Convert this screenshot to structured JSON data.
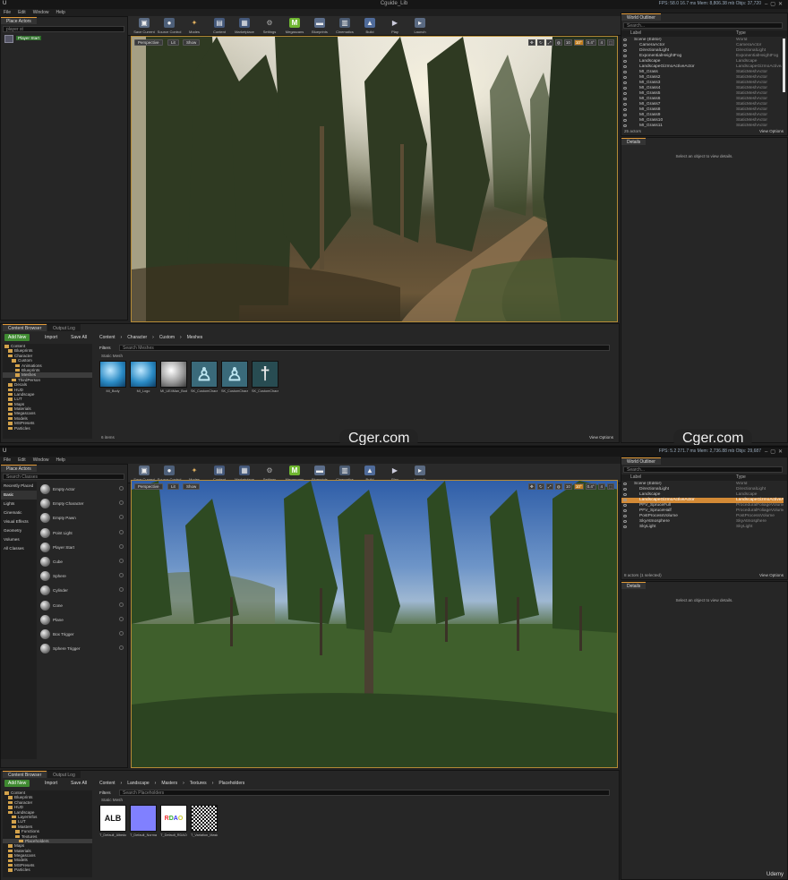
{
  "editor1": {
    "title": "Cguide_Lib",
    "stats": "FPS: 58.0   16.7 ms   Mem: 8,806.38 mb   Objs: 37,720",
    "menu": [
      "File",
      "Edit",
      "Window",
      "Help"
    ],
    "place_actors_tab": "Place Actors",
    "search_text": "player st",
    "place_result": "Player Start",
    "toolbar": [
      "Save Current",
      "Source Control",
      "Modes",
      "Content",
      "Marketplace",
      "Settings",
      "Megascans",
      "Blueprints",
      "Cinematics",
      "Build",
      "Play",
      "Launch"
    ],
    "viewport_buttons": [
      "Perspective",
      "Lit",
      "Show"
    ],
    "viewport_right": [
      "10",
      "10°",
      "0.4°",
      "4",
      "0.02",
      "1.0",
      "Unlit",
      "Editor"
    ],
    "world_outliner_tab": "World Outliner",
    "outliner_search": "Search...",
    "outliner_cols": [
      "Label",
      "Type"
    ],
    "outliner_rows": [
      {
        "label": "Scene (Editor)",
        "type": "World"
      },
      {
        "label": "CameraActor",
        "type": "CameraActor"
      },
      {
        "label": "DirectionalLight",
        "type": "DirectionalLight"
      },
      {
        "label": "ExponentialHeightFog",
        "type": "ExponentialHeightFog"
      },
      {
        "label": "Landscape",
        "type": "Landscape"
      },
      {
        "label": "LandscapeGizmoActiveActor",
        "type": "LandscapeGizmoActiveActor"
      },
      {
        "label": "MI_Grass",
        "type": "StaticMeshActor"
      },
      {
        "label": "MI_Grass2",
        "type": "StaticMeshActor"
      },
      {
        "label": "MI_Grass3",
        "type": "StaticMeshActor"
      },
      {
        "label": "MI_Grass4",
        "type": "StaticMeshActor"
      },
      {
        "label": "MI_Grass5",
        "type": "StaticMeshActor"
      },
      {
        "label": "MI_Grass6",
        "type": "StaticMeshActor"
      },
      {
        "label": "MI_Grass7",
        "type": "StaticMeshActor"
      },
      {
        "label": "MI_Grass8",
        "type": "StaticMeshActor"
      },
      {
        "label": "MI_Grass9",
        "type": "StaticMeshActor"
      },
      {
        "label": "MI_Grass10",
        "type": "StaticMeshActor"
      },
      {
        "label": "MI_Grass11",
        "type": "StaticMeshActor"
      }
    ],
    "outliner_count": "25 actors",
    "view_options": "View Options",
    "details_tab": "Details",
    "details_msg": "Select an object to view details.",
    "content_browser_tab": "Content Browser",
    "output_log_tab": "Output Log",
    "add_new": "Add New",
    "import": "Import",
    "save_all": "Save All",
    "breadcrumb": [
      "Content",
      "Character",
      "Custom",
      "Meshes"
    ],
    "filters": "Filters",
    "search_assets": "Search Meshes",
    "section_label": "Static Mesh",
    "tree": [
      {
        "label": "Content",
        "indent": 0
      },
      {
        "label": "Blueprints",
        "indent": 1
      },
      {
        "label": "Character",
        "indent": 1
      },
      {
        "label": "Custom",
        "indent": 2
      },
      {
        "label": "Animations",
        "indent": 3
      },
      {
        "label": "Blueprints",
        "indent": 3
      },
      {
        "label": "Meshes",
        "indent": 3,
        "sel": true
      },
      {
        "label": "ThirdPerson",
        "indent": 2
      },
      {
        "label": "Decals",
        "indent": 1
      },
      {
        "label": "HUD",
        "indent": 1
      },
      {
        "label": "Landscape",
        "indent": 1
      },
      {
        "label": "LUT",
        "indent": 1
      },
      {
        "label": "Maps",
        "indent": 1
      },
      {
        "label": "Materials",
        "indent": 1
      },
      {
        "label": "Megascans",
        "indent": 1
      },
      {
        "label": "Models",
        "indent": 1
      },
      {
        "label": "MSPresets",
        "indent": 1
      },
      {
        "label": "Particles",
        "indent": 1
      }
    ],
    "assets": [
      {
        "name": "MI_Body",
        "kind": "ball-blue"
      },
      {
        "name": "MI_Logo",
        "kind": "ball-blue"
      },
      {
        "name": "MI_UE4Man_Body",
        "kind": "ball-gray"
      },
      {
        "name": "SK_CustomChara",
        "kind": "figure"
      },
      {
        "name": "SK_CustomChara_PhysicsAsset",
        "kind": "figure"
      },
      {
        "name": "SK_CustomChara_Skeleton",
        "kind": "skeleton"
      }
    ],
    "items_count": "6 items",
    "watermark": "Cger.com"
  },
  "editor2": {
    "stats": "FPS: 5.2   271.7 ms   Mem: 2,736.88 mb   Objs: 29,687",
    "menu": [
      "File",
      "Edit",
      "Window",
      "Help"
    ],
    "place_actors_tab": "Place Actors",
    "search_classes": "Search Classes",
    "categories": [
      "Recently Placed",
      "Basic",
      "Lights",
      "Cinematic",
      "Visual Effects",
      "Geometry",
      "Volumes",
      "All Classes"
    ],
    "active_category": "Basic",
    "actors": [
      "Empty Actor",
      "Empty Character",
      "Empty Pawn",
      "Point Light",
      "Player Start",
      "Cube",
      "Sphere",
      "Cylinder",
      "Cone",
      "Plane",
      "Box Trigger",
      "Sphere Trigger"
    ],
    "toolbar": [
      "Save Current",
      "Source Control",
      "Modes",
      "Content",
      "Marketplace",
      "Settings",
      "Megascans",
      "Blueprints",
      "Cinematics",
      "Build",
      "Play",
      "Launch"
    ],
    "viewport_buttons": [
      "Perspective",
      "Lit",
      "Show"
    ],
    "viewport_right": [
      "10",
      "10°",
      "0.4°",
      "4",
      "0.02",
      "1.0"
    ],
    "world_outliner_tab": "World Outliner",
    "outliner_search": "Search...",
    "outliner_cols": [
      "Label",
      "Type"
    ],
    "outliner_rows": [
      {
        "label": "Scene (Editor)",
        "type": "World"
      },
      {
        "label": "DirectionalLight",
        "type": "DirectionalLight"
      },
      {
        "label": "Landscape",
        "type": "Landscape"
      },
      {
        "label": "LandscapeGizmoActiveActor",
        "type": "LandscapeGizmoActiveActor",
        "sel": true
      },
      {
        "label": "PFV_SpruceFull",
        "type": "ProceduralFoliageVolume"
      },
      {
        "label": "PFV_SpruceHalf",
        "type": "ProceduralFoliageVolume"
      },
      {
        "label": "PostProcessVolume",
        "type": "PostProcessVolume"
      },
      {
        "label": "SkyAtmosphere",
        "type": "SkyAtmosphere"
      },
      {
        "label": "SkyLight",
        "type": "SkyLight"
      }
    ],
    "outliner_count": "8 actors (1 selected)",
    "view_options": "View Options",
    "details_tab": "Details",
    "details_msg": "Select an object to view details.",
    "content_browser_tab": "Content Browser",
    "output_log_tab": "Output Log",
    "add_new": "Add New",
    "import": "Import",
    "save_all": "Save All",
    "breadcrumb": [
      "Content",
      "Landscape",
      "Masters",
      "Textures",
      "Placeholders"
    ],
    "filters": "Filters",
    "search_assets": "Search Placeholders",
    "section_label": "Static Mesh",
    "tree": [
      {
        "label": "Content",
        "indent": 0
      },
      {
        "label": "Blueprints",
        "indent": 1
      },
      {
        "label": "Character",
        "indent": 1
      },
      {
        "label": "HUD",
        "indent": 1
      },
      {
        "label": "Landscape",
        "indent": 1
      },
      {
        "label": "LayerInfos",
        "indent": 2
      },
      {
        "label": "LUT",
        "indent": 2
      },
      {
        "label": "Masters",
        "indent": 2
      },
      {
        "label": "Functions",
        "indent": 3
      },
      {
        "label": "Textures",
        "indent": 3
      },
      {
        "label": "Placeholders",
        "indent": 4,
        "sel": true
      },
      {
        "label": "Maps",
        "indent": 1
      },
      {
        "label": "Materials",
        "indent": 1
      },
      {
        "label": "Megascans",
        "indent": 1
      },
      {
        "label": "Models",
        "indent": 1
      },
      {
        "label": "MSPresets",
        "indent": 1
      },
      {
        "label": "Particles",
        "indent": 1
      }
    ],
    "assets": [
      {
        "name": "T_Default_Albedo",
        "kind": "ALB"
      },
      {
        "name": "T_Default_Normal",
        "kind": "normal"
      },
      {
        "name": "T_Default_RDAO",
        "kind": "RDAO"
      },
      {
        "name": "T_Variation_Mask",
        "kind": "noise"
      }
    ],
    "udemy": "Udemy"
  },
  "colors": {
    "accent": "#e29b3a",
    "selection": "#d38a36",
    "add_new": "#3f8a31",
    "panel": "#262626"
  }
}
